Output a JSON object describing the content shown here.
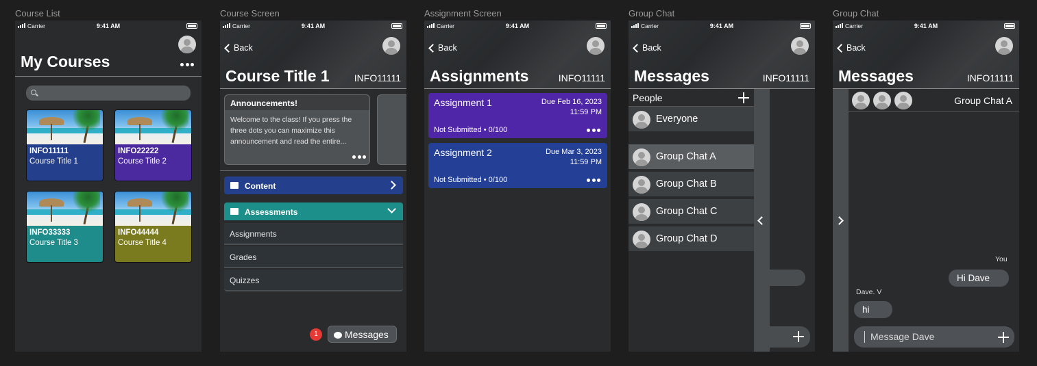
{
  "frame_labels": [
    "Course List",
    "Course Screen",
    "Assignment Screen",
    "Group Chat",
    "Group Chat"
  ],
  "status": {
    "carrier": "Carrier",
    "time": "9:41 AM"
  },
  "course_list": {
    "title": "My Courses",
    "search_placeholder": "",
    "courses": [
      {
        "code": "INFO11111",
        "title": "Course Title 1",
        "color": "#243f8c"
      },
      {
        "code": "INFO22222",
        "title": "Course Title 2",
        "color": "#4b2aa0"
      },
      {
        "code": "INFO33333",
        "title": "Course Title 3",
        "color": "#1f8c8c"
      },
      {
        "code": "INFO44444",
        "title": "Course Title 4",
        "color": "#7a7a1e"
      }
    ]
  },
  "course_screen": {
    "back": "Back",
    "title": "Course Title 1",
    "code": "INFO11111",
    "announcement": {
      "heading": "Announcements!",
      "body": "Welcome to the class! If you press the three dots you can maximize this announcement and read the entire..."
    },
    "content_label": "Content",
    "assessments_label": "Assessments",
    "assessment_items": [
      "Assignments",
      "Grades",
      "Quizzes"
    ],
    "badge_count": "1",
    "messages_label": "Messages",
    "colors": {
      "content": "#243f8c",
      "assessments": "#1d8f8a"
    }
  },
  "assignment_screen": {
    "back": "Back",
    "title": "Assignments",
    "code": "INFO11111",
    "items": [
      {
        "title": "Assignment 1",
        "due_date": "Due Feb 16, 2023",
        "due_time": "11:59 PM",
        "status": "Not Submitted • 0/100",
        "color": "#5026a8"
      },
      {
        "title": "Assignment 2",
        "due_date": "Due Mar 3, 2023",
        "due_time": "11:59 PM",
        "status": "Not Submitted • 0/100",
        "color": "#233f96"
      }
    ]
  },
  "group_chat_list": {
    "back": "Back",
    "title": "Messages",
    "code": "INFO11111",
    "people_label": "People",
    "everyone": "Everyone",
    "groups": [
      "Group Chat A",
      "Group Chat B",
      "Group Chat C",
      "Group Chat D"
    ]
  },
  "group_chat_open": {
    "back": "Back",
    "title": "Messages",
    "code": "INFO11111",
    "chat_name": "Group Chat A",
    "me_label": "You",
    "my_message": "Hi Dave",
    "other_label": "Dave. V",
    "other_message": "hi",
    "compose_placeholder": "Message Dave"
  }
}
